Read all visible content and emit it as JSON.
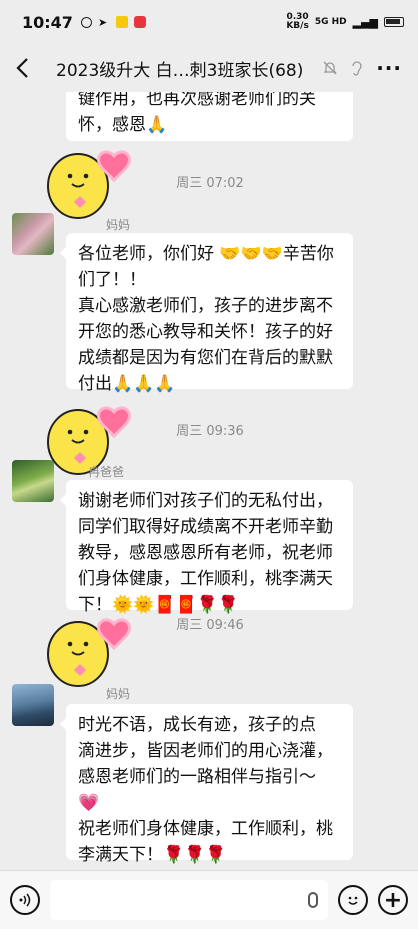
{
  "status_bar": {
    "time": "10:47",
    "net_speed_value": "0.30",
    "net_speed_unit": "KB/s",
    "signal": "5G HD"
  },
  "nav": {
    "title": "2023级升大 白…刺3班家长(68)",
    "back_icon": "chevron-left-icon",
    "mute_icon": "bell-off-icon",
    "ear_icon": "ear-icon",
    "more_icon": "more-icon",
    "more_label": "···"
  },
  "messages": [
    {
      "id": "msg0",
      "lines": [
        "键作用，也再次感谢老师们的关",
        "怀，感恩🙏"
      ]
    },
    {
      "id": "sticker1",
      "sticker": "yellow-bear-heart-sticker",
      "time": "周三 07:02"
    },
    {
      "id": "msg1",
      "sender": "妈妈",
      "avatar": "flower-avatar",
      "lines": [
        "各位老师，你们好 🤝🤝🤝辛苦你",
        "们了！！",
        "真心感激老师们，孩子的进步离不",
        "开您的悉心教导和关怀！孩子的好",
        "成绩都是因为有您们在背后的默默",
        "付出🙏🙏🙏"
      ]
    },
    {
      "id": "sticker2",
      "sticker": "yellow-bear-heart-sticker",
      "time": "周三 09:36"
    },
    {
      "id": "msg2",
      "sender": "冉爸爸",
      "avatar": "landscape-avatar",
      "lines": [
        "谢谢老师们对孩子们的无私付出，",
        "同学们取得好成绩离不开老师辛勤",
        "教导，感恩感恩所有老师，祝老师",
        "们身体健康，工作顺利，桃李满天",
        "下！🌞🌞🧧🧧🌹🌹"
      ]
    },
    {
      "id": "sticker3",
      "sticker": "yellow-bear-heart-sticker",
      "time": "周三 09:46"
    },
    {
      "id": "msg3",
      "sender": "妈妈",
      "avatar": "lake-avatar",
      "lines": [
        " 时光不语，成长有迹，孩子的点",
        "滴进步，皆因老师们的用心浇灌，",
        "感恩老师们的一路相伴与指引～",
        "💗",
        "祝老师们身体健康，工作顺利，桃",
        "李满天下！🌹🌹🌹"
      ]
    }
  ],
  "input_bar": {
    "voice_icon": "voice-icon",
    "mic_icon": "mic-icon",
    "emoji_icon": "emoji-icon",
    "plus_icon": "plus-icon",
    "plus_label": "+"
  },
  "colors": {
    "background": "#ededed",
    "bubble": "#ffffff",
    "time_text": "#8a8a8a",
    "sticker_yellow": "#fbe34a",
    "heart_pink": "#ff6f9c"
  }
}
